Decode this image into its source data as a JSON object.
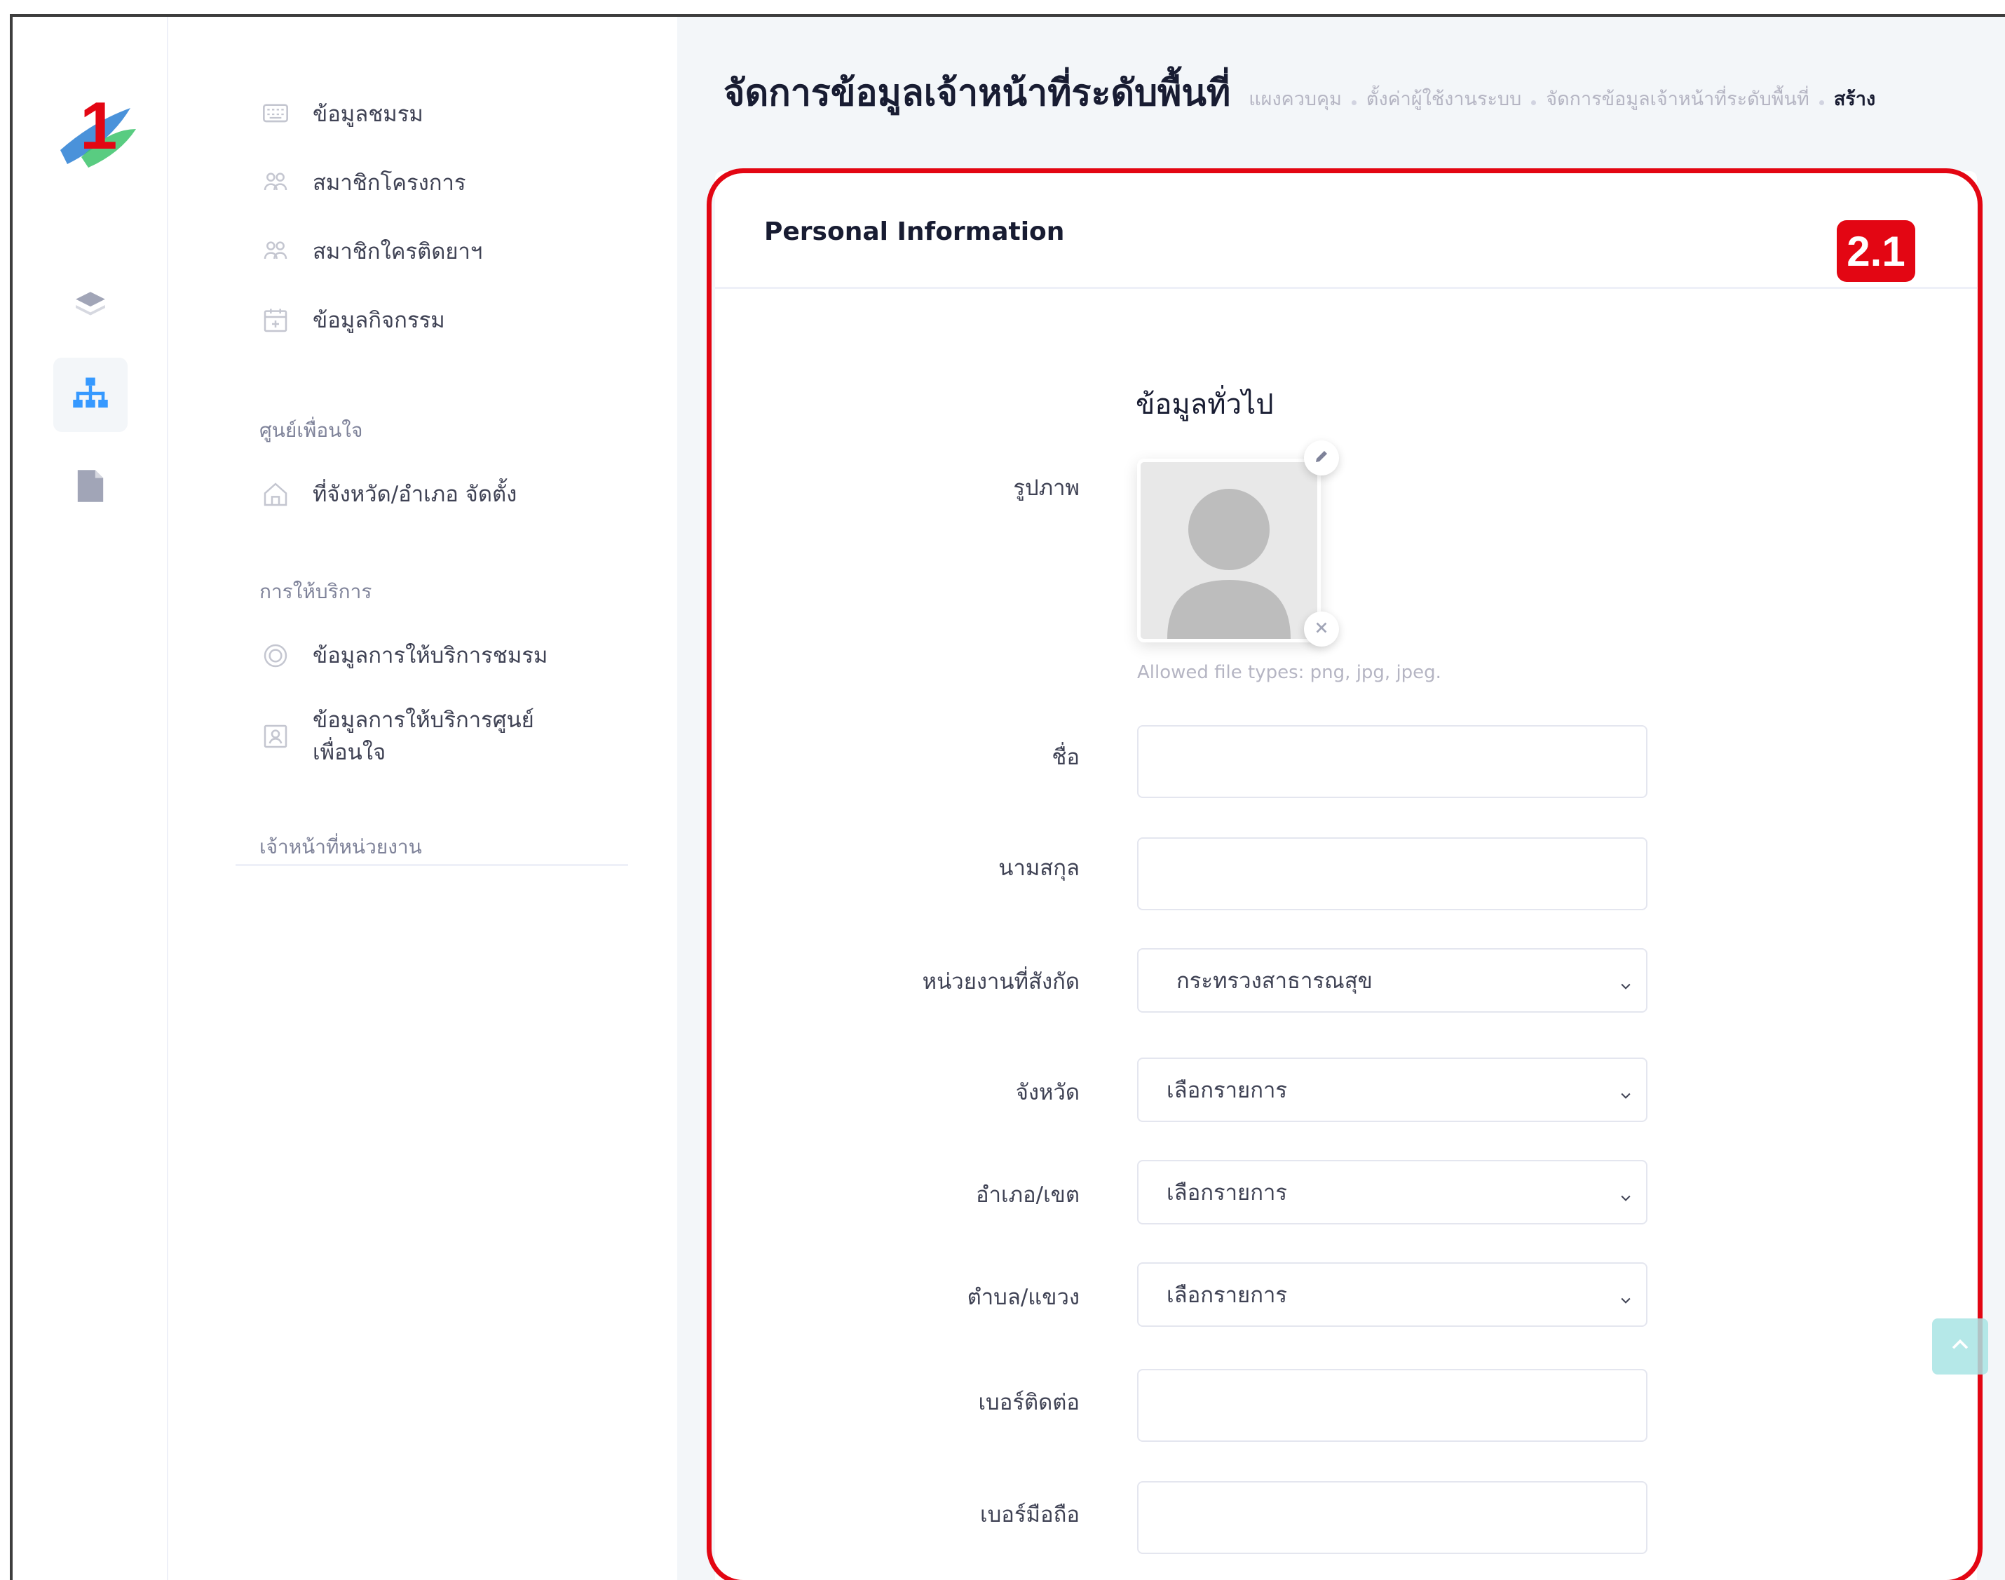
{
  "sidebar": {
    "logo_text": "1",
    "items": [
      {
        "label": "ข้อมูลชมรม",
        "icon": "keyboard-icon"
      },
      {
        "label": "สมาชิกโครงการ",
        "icon": "users-icon"
      },
      {
        "label": "สมาชิกใครติดยาฯ",
        "icon": "users-icon"
      },
      {
        "label": "ข้อมูลกิจกรรม",
        "icon": "calendar-add-icon"
      }
    ],
    "section_friend": "ศูนย์เพื่อนใจ",
    "friend_item": "ที่จังหวัด/อำเภอ จัดตั้ง",
    "section_service": "การให้บริการ",
    "service_items": [
      {
        "label": "ข้อมูลการให้บริการชมรม",
        "icon": "disc-icon"
      },
      {
        "label": "ข้อมูลการให้บริการศูนย์",
        "label2": "เพื่อนใจ",
        "icon": "contact-card-icon"
      }
    ],
    "section_staff": "เจ้าหน้าที่หน่วยงาน"
  },
  "header": {
    "title": "จัดการข้อมูลเจ้าหน้าที่ระดับพื้นที่",
    "breadcrumb": [
      "แผงควบคุม",
      "ตั้งค่าผู้ใช้งานระบบ",
      "จัดการข้อมูลเจ้าหน้าที่ระดับพื้นที่",
      "สร้าง"
    ]
  },
  "card": {
    "title": "Personal Information",
    "badge": "2.1",
    "section_title": "ข้อมูลทั่วไป"
  },
  "form": {
    "photo_label": "รูปภาพ",
    "photo_hint": "Allowed file types: png, jpg, jpeg.",
    "first_name_label": "ชื่อ",
    "first_name_value": "",
    "last_name_label": "นามสกุล",
    "last_name_value": "",
    "agency_label": "หน่วยงานที่สังกัด",
    "agency_value": "กระทรวงสาธารณสุข",
    "province_label": "จังหวัด",
    "province_value": "เลือกรายการ",
    "district_label": "อำเภอ/เขต",
    "district_value": "เลือกรายการ",
    "subdistrict_label": "ตำบล/แขวง",
    "subdistrict_value": "เลือกรายการ",
    "phone_label": "เบอร์ติดต่อ",
    "phone_value": "",
    "mobile_label": "เบอร์มือถือ",
    "mobile_value": ""
  },
  "colors": {
    "highlight": "#e30613",
    "accent": "#3699ff",
    "scrolltop": "#a9e5e5"
  }
}
